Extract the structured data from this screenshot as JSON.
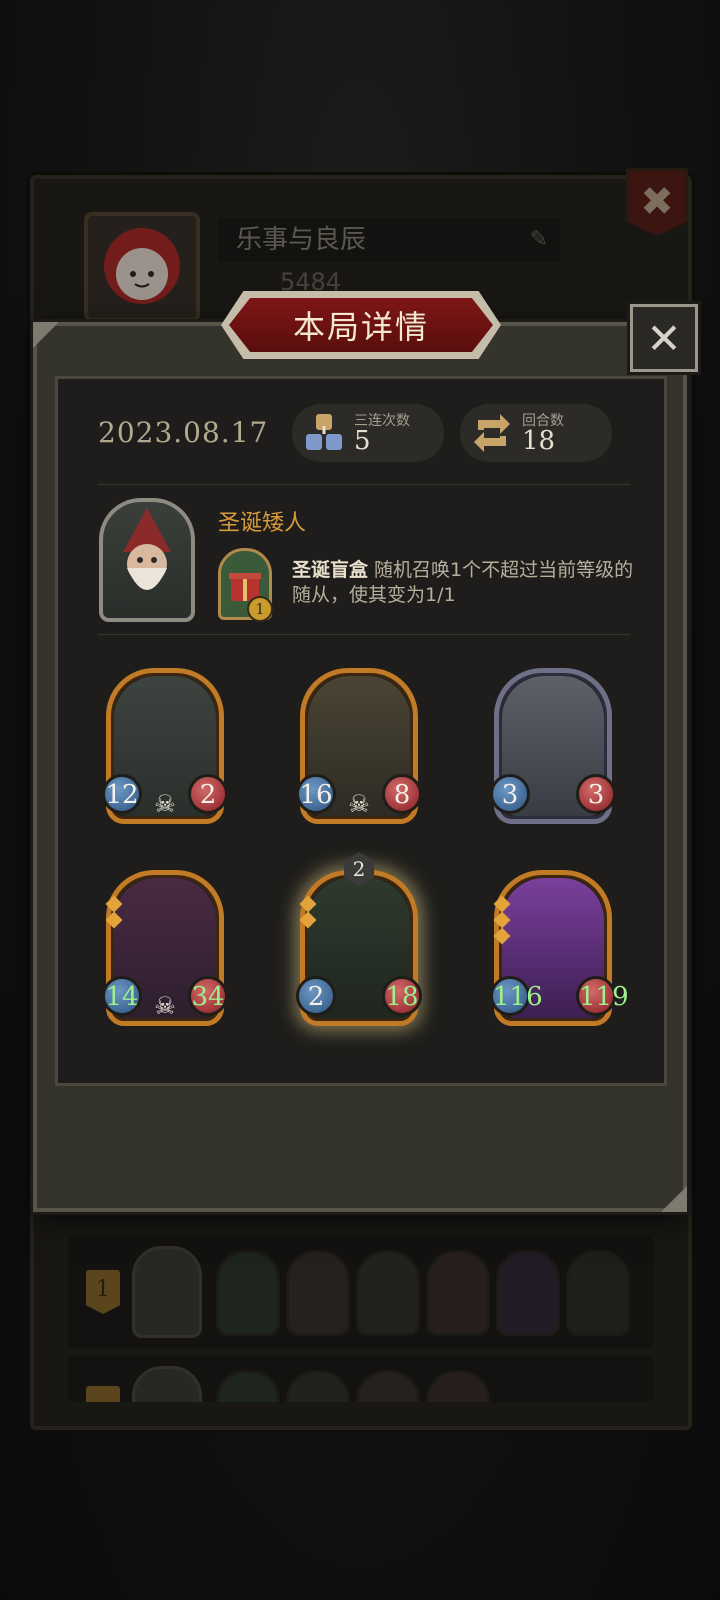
{
  "background": {
    "player_name": "乐事与良辰",
    "score": "5484",
    "close_glyph": "✖",
    "rows": [
      {
        "rank": "1"
      },
      {
        "rank": ""
      }
    ]
  },
  "modal": {
    "title": "本局详情",
    "close_glyph": "✕",
    "date": "2023.08.17",
    "stats": [
      {
        "label": "三连次数",
        "value": "5",
        "icon": "triple-cubes-icon"
      },
      {
        "label": "回合数",
        "value": "18",
        "icon": "turn-cycle-icon"
      }
    ],
    "hero": {
      "name": "圣诞矮人",
      "power_cost": "1",
      "power_name": "圣诞盲盒",
      "power_text": " 随机召唤1个不超过当前等级的随从，使其变为1/1"
    },
    "minions": [
      {
        "attack": "12",
        "health": "2",
        "deathrattle": true,
        "frame": "gold",
        "attack_buffed": false,
        "health_buffed": false
      },
      {
        "attack": "16",
        "health": "8",
        "deathrattle": true,
        "frame": "gold",
        "attack_buffed": false,
        "health_buffed": false
      },
      {
        "attack": "3",
        "health": "3",
        "deathrattle": false,
        "frame": "silver",
        "attack_buffed": false,
        "health_buffed": false
      },
      {
        "attack": "14",
        "health": "34",
        "deathrattle": true,
        "frame": "gold",
        "attack_buffed": true,
        "health_buffed": true
      },
      {
        "attack": "2",
        "health": "18",
        "deathrattle": false,
        "frame": "gold",
        "level": "2",
        "attack_buffed": false,
        "health_buffed": true
      },
      {
        "attack": "116",
        "health": "119",
        "deathrattle": false,
        "frame": "gold",
        "attack_buffed": true,
        "health_buffed": true
      }
    ]
  },
  "colors": {
    "accent_gold": "#c17a25",
    "hero_name": "#d99a3c",
    "banner_red": "#6a1212"
  }
}
